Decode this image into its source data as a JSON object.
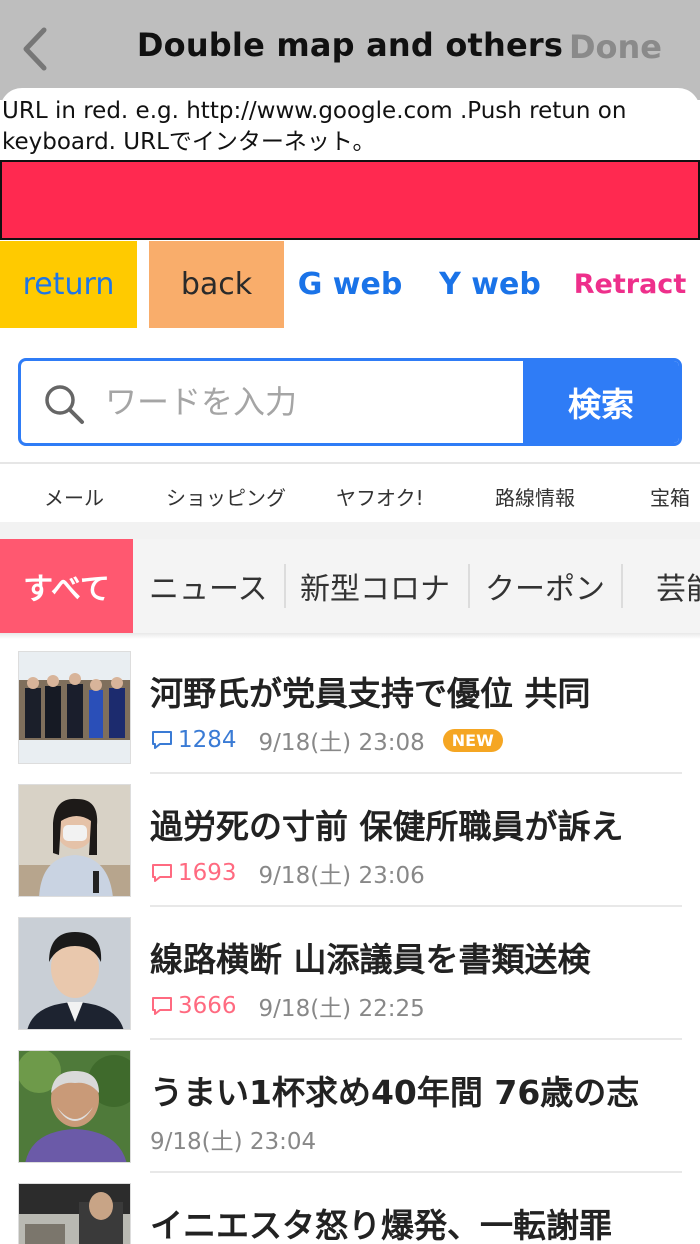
{
  "navbar": {
    "title": "Double map and others",
    "done_label": "Done"
  },
  "instruction": "URL in  red.  e.g. http://www.google.com .Push retun on keyboard.   URLでインターネット。",
  "url_bar": {
    "value": "",
    "color": "#ff2950"
  },
  "buttons": {
    "return_label": "return",
    "back_label": "back",
    "gweb_label": "G web",
    "yweb_label": "Y web",
    "retract_label": "Retract"
  },
  "search": {
    "placeholder": "ワードを入力",
    "button_label": "検索"
  },
  "services": [
    "メール",
    "ショッピング",
    "ヤフオク!",
    "路線情報",
    "宝箱"
  ],
  "tabs": [
    "すべて",
    "ニュース",
    "新型コロナ",
    "クーポン",
    "芸能"
  ],
  "news": [
    {
      "title": "河野氏が党員支持で優位 共同",
      "comments": "1284",
      "time": "9/18(土) 23:08",
      "badge": "NEW",
      "comment_color": "#3a7bd5"
    },
    {
      "title": "過労死の寸前 保健所職員が訴え",
      "comments": "1693",
      "time": "9/18(土) 23:06",
      "comment_color": "#ff6a80"
    },
    {
      "title": "線路横断 山添議員を書類送検",
      "comments": "3666",
      "time": "9/18(土) 22:25",
      "comment_color": "#ff6a80"
    },
    {
      "title": "うまい1杯求め40年間 76歳の志",
      "time": "9/18(土) 23:04"
    },
    {
      "title": "イニエスタ怒り爆発、一転謝罪"
    }
  ],
  "colors": {
    "accent_blue": "#2f7cf6",
    "tab_active": "#ff5870",
    "retract_pink": "#ee2f8b"
  }
}
